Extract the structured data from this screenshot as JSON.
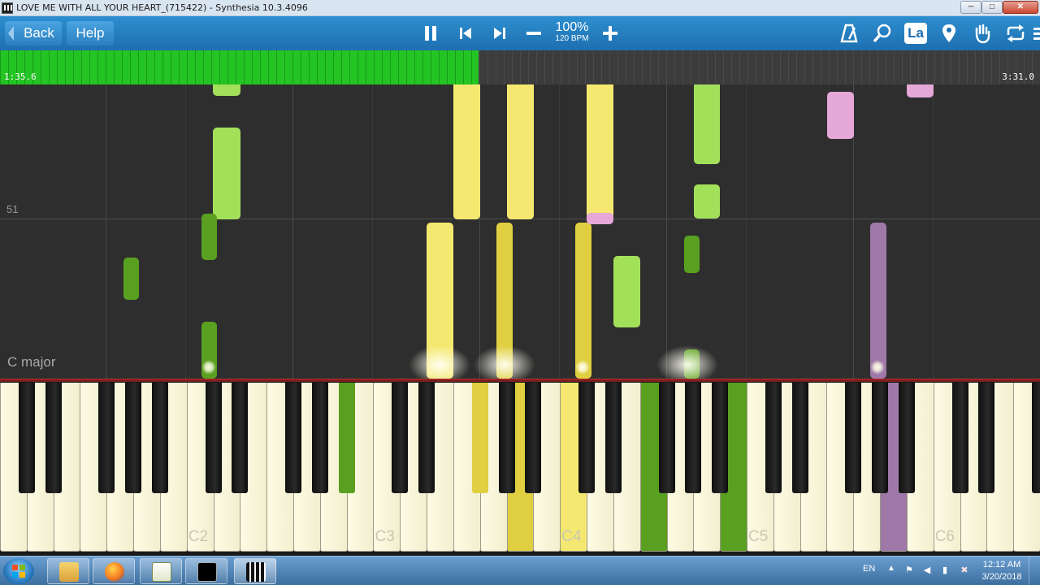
{
  "window": {
    "title": "LOVE ME WITH ALL YOUR HEART_(715422) - Synthesia 10.3.4096",
    "minimize": "─",
    "maximize": "□",
    "close": "✕"
  },
  "toolbar": {
    "back_label": "Back",
    "help_label": "Help",
    "speed_percent": "100%",
    "tempo": "120 BPM",
    "note_label_icon_text": "La",
    "icons": [
      "pause-icon",
      "skip-back-icon",
      "skip-forward-icon",
      "minus-icon",
      "plus-icon",
      "metronome-icon",
      "magnifier-icon",
      "note-label-icon",
      "location-pin-icon",
      "hand-icon",
      "loop-icon",
      "menu-icon"
    ]
  },
  "timeline": {
    "current_time": "1:35.6",
    "total_time": "3:31.0",
    "progress": 0.46
  },
  "roll": {
    "measure_number": "51",
    "key_signature": "C major"
  },
  "keyboard": {
    "octave_labels": [
      "C2",
      "C3",
      "C4",
      "C5",
      "C6"
    ],
    "pressed_keys": [
      "A#2",
      "F#3",
      "A3",
      "C4",
      "F4",
      "B4",
      "A5"
    ]
  },
  "colors": {
    "left_hand": "#a3e05a",
    "left_hand_dark": "#5aa020",
    "right_hand": "#f5e870",
    "right_hand_dark": "#e0cf40",
    "other_track": "#e5a8d9",
    "other_track_dark": "#9f78a8",
    "progress": "#24c424",
    "toolbar": "#2680c3"
  },
  "taskbar": {
    "language": "EN",
    "time": "12:12 AM",
    "date": "3/20/2018",
    "apps": [
      "windows-explorer-icon",
      "firefox-icon",
      "notepad-icon",
      "command-prompt-icon",
      "synthesia-icon"
    ]
  }
}
